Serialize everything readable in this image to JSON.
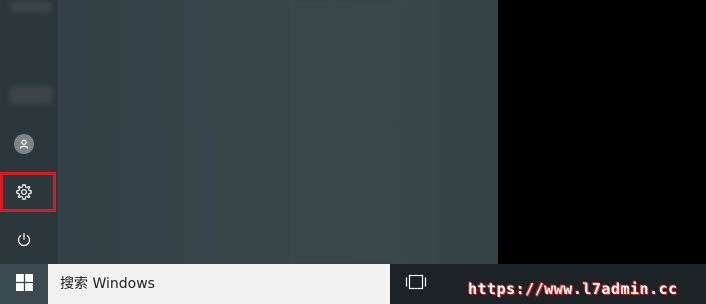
{
  "taskbar": {
    "start_icon": "windows-logo-icon",
    "search": {
      "placeholder": "搜索 Windows"
    },
    "task_view_icon": "task-view-icon"
  },
  "start_menu": {
    "rail": {
      "account_icon": "user-account-icon",
      "settings_icon": "gear-icon",
      "power_icon": "power-icon"
    },
    "highlight_color": "#d71b22"
  },
  "watermark": {
    "text": "https://www.l7admin.cc"
  },
  "colors": {
    "start_menu_bg": "#2f3b3f",
    "taskbar_bg": "#1c2326",
    "search_bg": "#f2f2f2"
  }
}
